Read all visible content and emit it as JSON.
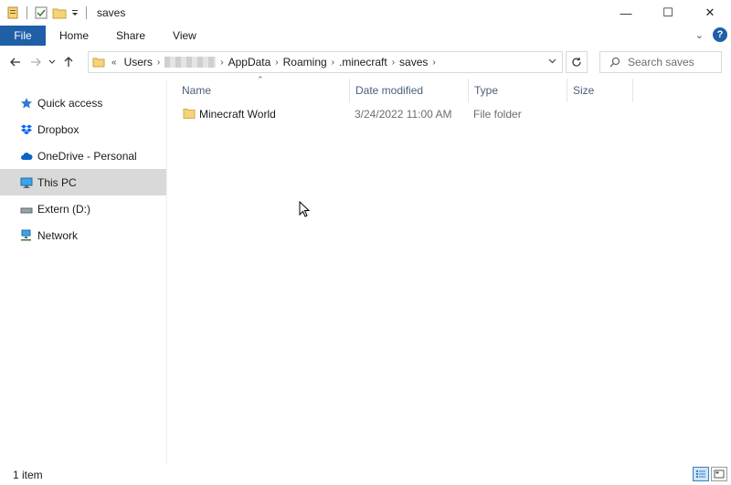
{
  "window": {
    "title": "saves",
    "controls": {
      "minimize": "—",
      "maximize": "☐",
      "close": "✕"
    }
  },
  "ribbon": {
    "file_tab": "File",
    "tabs": [
      "Home",
      "Share",
      "View"
    ]
  },
  "address_bar": {
    "overflow": "«",
    "crumbs": [
      "Users",
      "AppData",
      "Roaming",
      ".minecraft",
      "saves"
    ]
  },
  "search": {
    "placeholder": "Search saves"
  },
  "sidebar": {
    "items": [
      {
        "label": "Quick access",
        "icon": "star-icon"
      },
      {
        "label": "Dropbox",
        "icon": "dropbox-icon"
      },
      {
        "label": "OneDrive - Personal",
        "icon": "cloud-icon"
      },
      {
        "label": "This PC",
        "icon": "computer-icon",
        "selected": true
      },
      {
        "label": "Extern (D:)",
        "icon": "drive-icon"
      },
      {
        "label": "Network",
        "icon": "network-icon"
      }
    ]
  },
  "file_list": {
    "columns": [
      "Name",
      "Date modified",
      "Type",
      "Size"
    ],
    "rows": [
      {
        "name": "Minecraft World",
        "date_modified": "3/24/2022 11:00 AM",
        "type": "File folder",
        "size": ""
      }
    ]
  },
  "status_bar": {
    "item_count": "1 item"
  },
  "colors": {
    "accent": "#1f5fa8",
    "selected_bg": "#d9d9d9",
    "folder": "#f6d37a",
    "header_text": "#4c607a"
  }
}
